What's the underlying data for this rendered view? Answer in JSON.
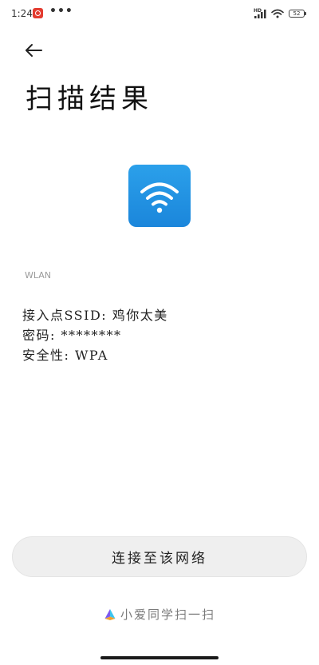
{
  "status_bar": {
    "time": "1:24",
    "overflow": "•••",
    "network_label": "HD",
    "battery": "52",
    "notification_icon": "red-app-notification-icon",
    "signal_icon": "cellular-signal-icon",
    "wifi_icon": "wifi-icon",
    "battery_icon": "battery-icon"
  },
  "header": {
    "back_icon": "arrow-left-icon",
    "title": "扫描结果"
  },
  "result": {
    "icon": "wifi-icon",
    "icon_color": "#2196e3",
    "type_label": "WLAN",
    "ssid_line": "接入点SSID: 鸡你太美",
    "password_line": "密码: ********",
    "security_line": "安全性: WPA"
  },
  "actions": {
    "connect_label": "连接至该网络"
  },
  "footer": {
    "brand_icon": "xiaoai-logo-icon",
    "brand_text": "小爱同学扫一扫"
  },
  "colors": {
    "background": "#ffffff",
    "button_bg": "#efefef",
    "text_primary": "#222222",
    "text_muted": "#9a9a9a"
  }
}
